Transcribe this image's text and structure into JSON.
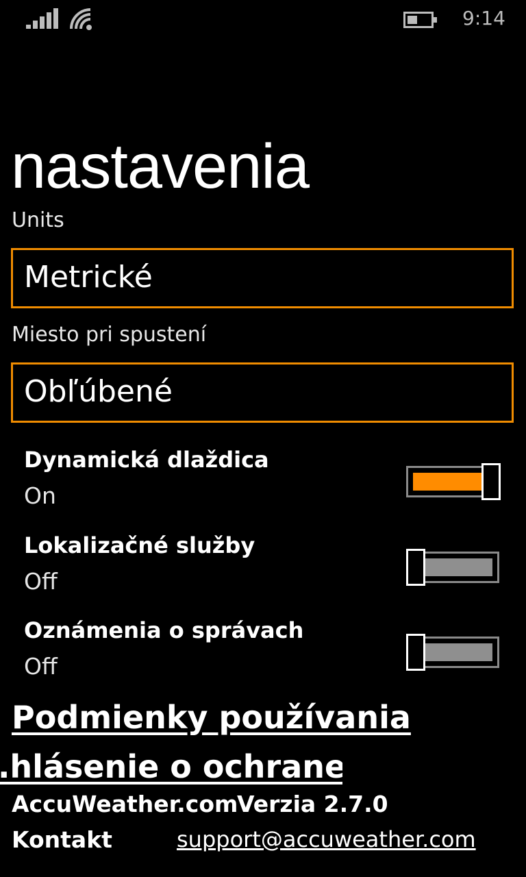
{
  "status_bar": {
    "time": "9:14"
  },
  "page": {
    "title": "nastavenia"
  },
  "settings": {
    "units": {
      "label": "Units",
      "value": "Metrické"
    },
    "startup_location": {
      "label": "Miesto pri spustení",
      "value": "Obľúbené"
    }
  },
  "toggles": [
    {
      "title": "Dynamická dlaždica",
      "state": "On",
      "on": true
    },
    {
      "title": "Lokalizačné služby",
      "state": "Off",
      "on": false
    },
    {
      "title": "Oznámenia o správach",
      "state": "Off",
      "on": false
    }
  ],
  "links": {
    "terms": "Podmienky používania",
    "privacy": "...hlásenie o ochrane..."
  },
  "footer": {
    "site": "AccuWeather.com",
    "version": "Verzia 2.7.0",
    "contact_label": "Kontakt",
    "email": "support@accuweather.com"
  },
  "colors": {
    "accent": "#f08c00",
    "off_track": "#8f8f8f"
  }
}
